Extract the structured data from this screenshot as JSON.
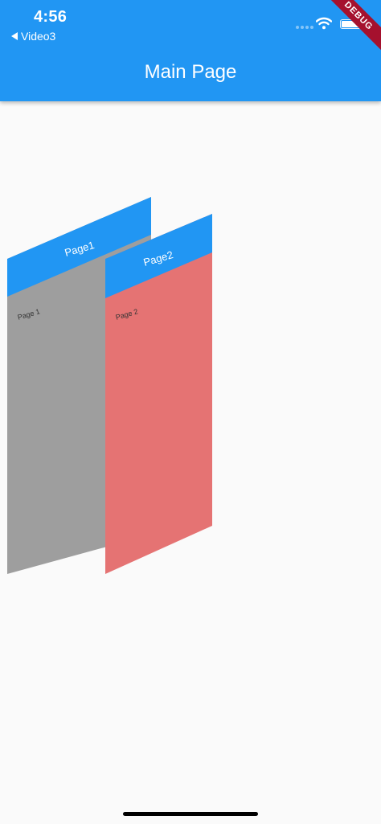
{
  "status_bar": {
    "time": "4:56",
    "back_app": "Video3",
    "debug_label": "DEBUG"
  },
  "app_bar": {
    "title": "Main Page"
  },
  "pages": [
    {
      "header": "Page1",
      "body": "Page 1",
      "header_color": "#2196f3",
      "body_color": "#9e9e9e"
    },
    {
      "header": "Page2",
      "body": "Page 2",
      "header_color": "#2196f3",
      "body_color": "#e57373"
    }
  ],
  "colors": {
    "primary": "#2196f3",
    "background": "#fafafa",
    "debug_banner": "#a5112e"
  }
}
